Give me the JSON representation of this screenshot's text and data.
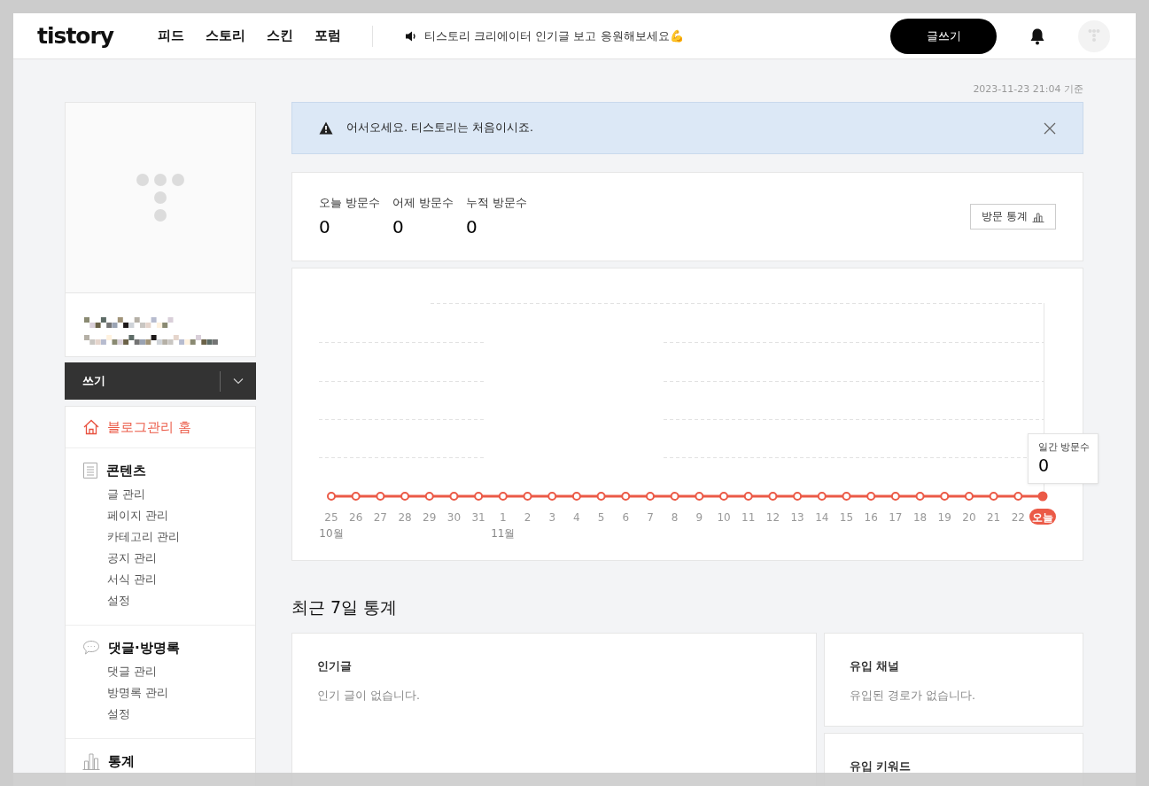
{
  "header": {
    "logo": "tistory",
    "nav": [
      {
        "label": "피드",
        "selected": false
      },
      {
        "label": "스토리",
        "selected": false
      },
      {
        "label": "스킨",
        "selected": false
      },
      {
        "label": "포럼",
        "selected": false
      }
    ],
    "notice": "티스토리 크리에이터 인기글 보고 응원해보세요💪",
    "write_button": "글쓰기"
  },
  "timestamp": "2023-11-23 21:04 기준",
  "sidebar": {
    "write_bar": "쓰기",
    "menu": [
      {
        "kind": "home",
        "label": "블로그관리 홈",
        "selected": true
      },
      {
        "kind": "section",
        "label": "콘텐츠",
        "items": [
          {
            "label": "글 관리",
            "selected": false
          },
          {
            "label": "페이지 관리",
            "selected": false
          },
          {
            "label": "카테고리 관리",
            "selected": false
          },
          {
            "label": "공지 관리",
            "selected": false
          },
          {
            "label": "서식 관리",
            "selected": false
          },
          {
            "label": "설정",
            "selected": false
          }
        ]
      },
      {
        "kind": "section",
        "label": "댓글·방명록",
        "items": [
          {
            "label": "댓글 관리",
            "selected": false
          },
          {
            "label": "방명록 관리",
            "selected": false
          },
          {
            "label": "설정",
            "selected": false
          }
        ]
      },
      {
        "kind": "section",
        "label": "통계"
      }
    ]
  },
  "alert": {
    "message": "어서오세요. 티스토리는 처음이시죠."
  },
  "stats": {
    "items": [
      {
        "label": "오늘 방문수",
        "value": "0"
      },
      {
        "label": "어제 방문수",
        "value": "0"
      },
      {
        "label": "누적 방문수",
        "value": "0"
      }
    ],
    "button": "방문 통계"
  },
  "chart": {
    "days": [
      {
        "label": "25",
        "month": "10월",
        "selected": false
      },
      {
        "label": "26",
        "selected": false
      },
      {
        "label": "27",
        "selected": false
      },
      {
        "label": "28",
        "selected": false
      },
      {
        "label": "29",
        "selected": false
      },
      {
        "label": "30",
        "selected": false
      },
      {
        "label": "31",
        "selected": false
      },
      {
        "label": "1",
        "month": "11월",
        "selected": false
      },
      {
        "label": "2",
        "selected": false
      },
      {
        "label": "3",
        "selected": false
      },
      {
        "label": "4",
        "selected": false
      },
      {
        "label": "5",
        "selected": false
      },
      {
        "label": "6",
        "selected": false
      },
      {
        "label": "7",
        "selected": false
      },
      {
        "label": "8",
        "selected": false
      },
      {
        "label": "9",
        "selected": false
      },
      {
        "label": "10",
        "selected": false
      },
      {
        "label": "11",
        "selected": false
      },
      {
        "label": "12",
        "selected": false
      },
      {
        "label": "13",
        "selected": false
      },
      {
        "label": "14",
        "selected": false
      },
      {
        "label": "15",
        "selected": false
      },
      {
        "label": "16",
        "selected": false
      },
      {
        "label": "17",
        "selected": false
      },
      {
        "label": "18",
        "selected": false
      },
      {
        "label": "19",
        "selected": false
      },
      {
        "label": "20",
        "selected": false
      },
      {
        "label": "21",
        "selected": false
      },
      {
        "label": "22",
        "selected": false
      },
      {
        "label": "오늘",
        "selected": true
      }
    ],
    "tooltip": {
      "title": "일간 방문수",
      "value": "0"
    }
  },
  "recent": {
    "title": "최근 7일 통계",
    "cards": [
      {
        "title": "인기글",
        "empty": "인기 글이 없습니다."
      },
      {
        "title": "유입 채널",
        "empty": "유입된 경로가 없습니다."
      },
      {
        "title": "유입 키워드"
      }
    ]
  }
}
